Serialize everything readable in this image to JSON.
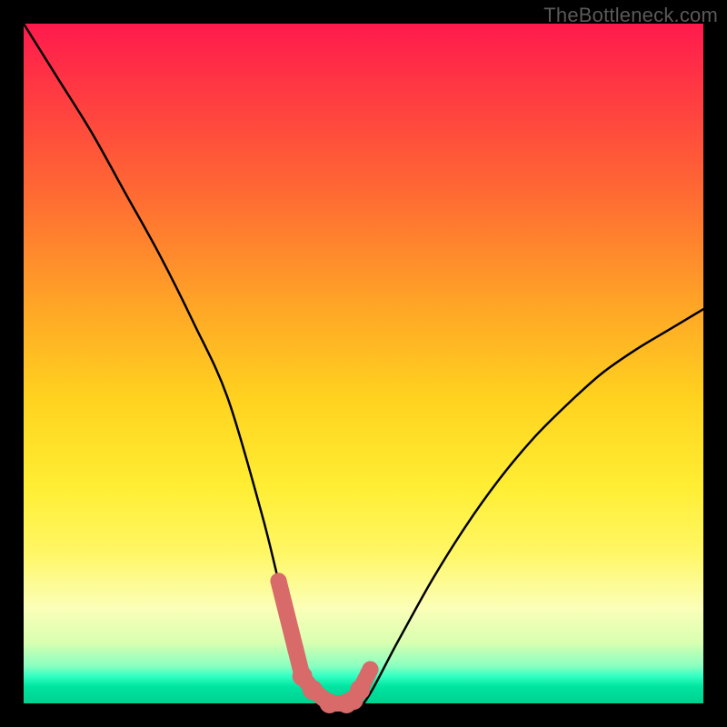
{
  "attribution": "TheBottleneck.com",
  "chart_data": {
    "type": "line",
    "title": "",
    "xlabel": "",
    "ylabel": "",
    "xlim": [
      0,
      100
    ],
    "ylim": [
      0,
      100
    ],
    "x": [
      0,
      5,
      10,
      15,
      20,
      25,
      30,
      35,
      37.5,
      40,
      42.5,
      45,
      47.5,
      50,
      55,
      60,
      65,
      70,
      75,
      80,
      85,
      90,
      95,
      100
    ],
    "values": [
      100,
      92,
      84,
      75,
      66,
      56,
      45,
      28,
      18,
      8,
      2,
      0,
      0,
      0,
      9,
      18,
      26,
      33,
      39,
      44,
      48.5,
      52,
      55,
      58
    ],
    "marker_points": {
      "x": [
        37.5,
        40,
        41,
        42.5,
        45,
        47.5,
        48.5,
        49.5,
        50,
        51
      ],
      "y": [
        18,
        8,
        4,
        2,
        0,
        0,
        0.5,
        2,
        3,
        5
      ]
    }
  }
}
